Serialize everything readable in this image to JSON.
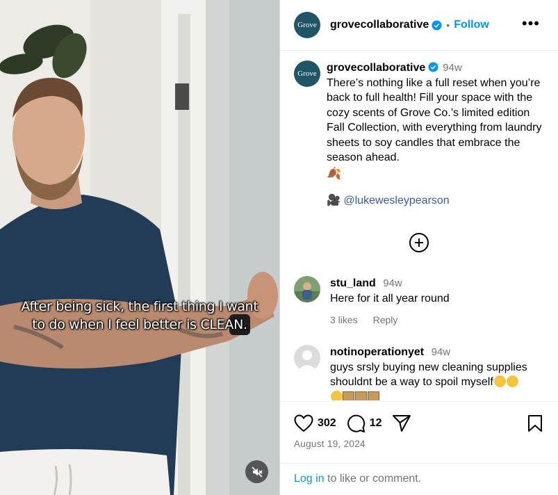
{
  "video": {
    "caption": "After being sick, the first thing I want to do when I feel better is CLEAN.",
    "mute_icon": "speaker-muted-icon"
  },
  "header": {
    "avatar_text": "Grove",
    "username": "grovecollaborative",
    "dot": "•",
    "follow_label": "Follow",
    "more_label": "•••"
  },
  "post_caption": {
    "avatar_text": "Grove",
    "username": "grovecollaborative",
    "age": "94w",
    "text": "There’s nothing like a full reset when you’re back to full health! Fill your space with the cozy scents of Grove Co.’s limited edition Fall Collection, with everything from laundry sheets to soy candles that embrace the season ahead.",
    "leaf_emoji": "🍂",
    "camera_emoji": "🎥",
    "mention": "@lukewesleypearson"
  },
  "load_more_icon": "plus-circle-icon",
  "comments": [
    {
      "username": "stu_land",
      "age": "94w",
      "text": "Here for it all year round",
      "likes": "3 likes",
      "reply": "Reply"
    },
    {
      "username": "notinoperationyet",
      "age": "94w",
      "text": "guys srsly buying new cleaning supplies shouldnt be a way to spoil myself"
    }
  ],
  "actions": {
    "like_count": "302",
    "comment_count": "12",
    "date": "August 19, 2024",
    "login_link": "Log in",
    "login_suffix": " to like or comment."
  },
  "colors": {
    "accent": "#0095f6",
    "brand": "#1f5564",
    "muted": "#737373"
  }
}
